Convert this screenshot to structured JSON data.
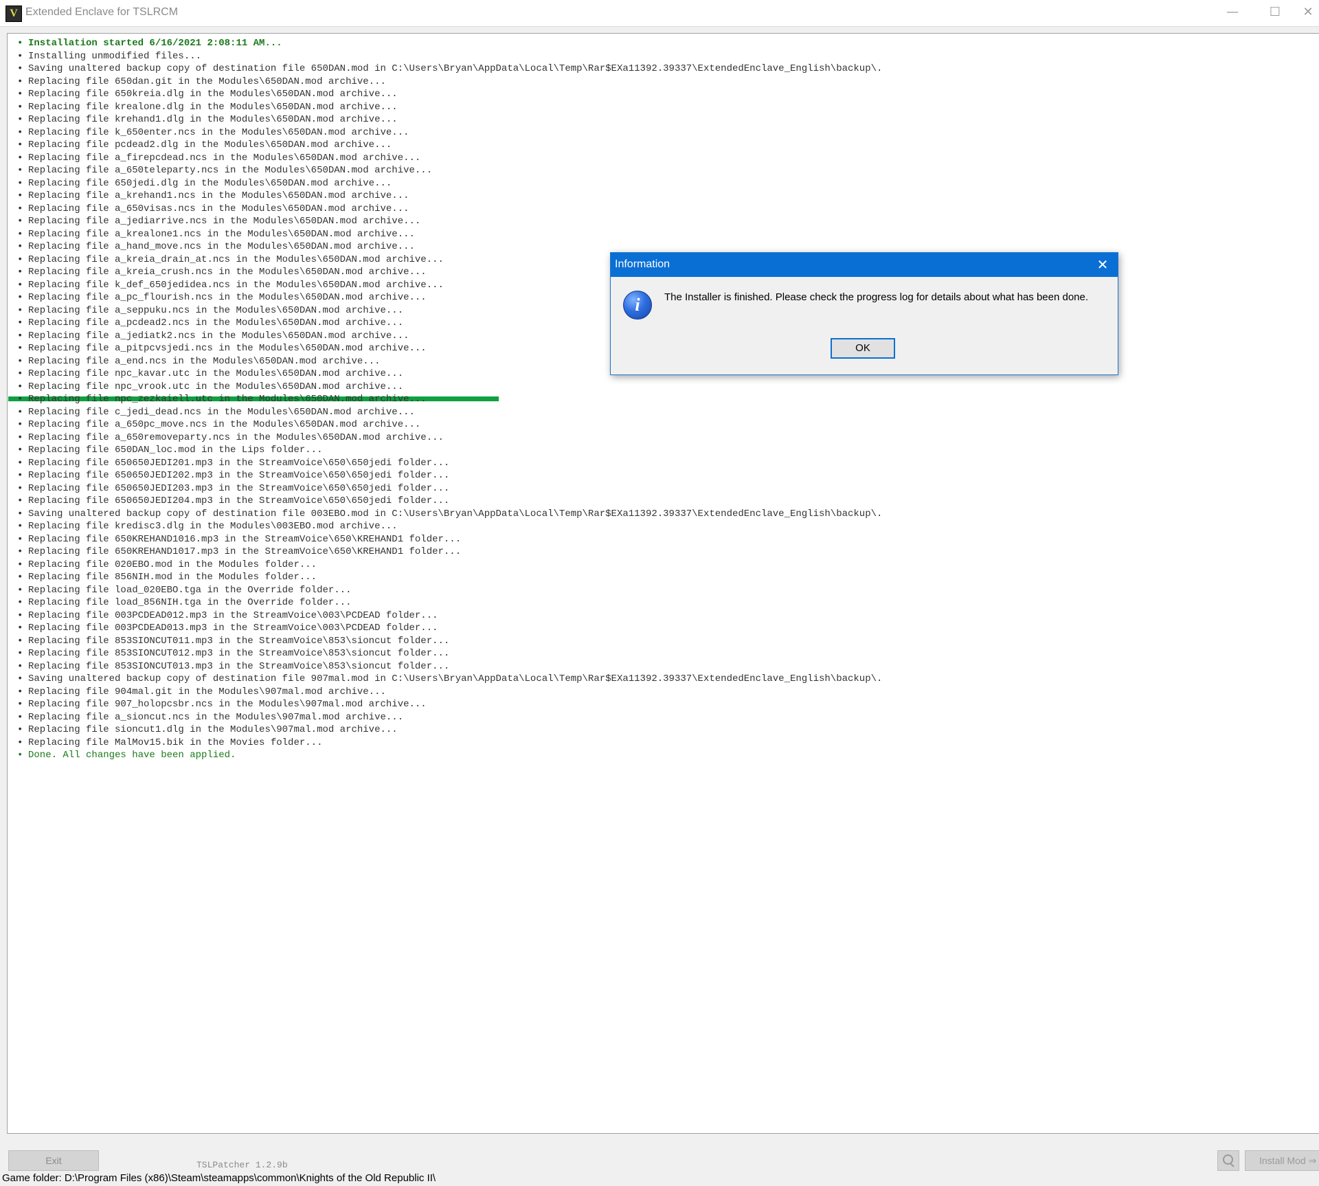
{
  "window": {
    "title": "Extended Enclave for TSLRCM",
    "app_icon_glyph": "V",
    "controls": {
      "minimize": "—",
      "maximize": "☐",
      "close": "✕"
    }
  },
  "log": {
    "lines": [
      {
        "text": "Installation started 6/16/2021 2:08:11 AM...",
        "style": "green"
      },
      {
        "text": "Installing unmodified files...",
        "style": "normal"
      },
      {
        "text": "Saving unaltered backup copy of destination file 650DAN.mod in C:\\Users\\Bryan\\AppData\\Local\\Temp\\Rar$EXa11392.39337\\ExtendedEnclave_English\\backup\\.",
        "style": "normal"
      },
      {
        "text": "Replacing file 650dan.git in the Modules\\650DAN.mod archive...",
        "style": "normal"
      },
      {
        "text": "Replacing file 650kreia.dlg in the Modules\\650DAN.mod archive...",
        "style": "normal"
      },
      {
        "text": "Replacing file krealone.dlg in the Modules\\650DAN.mod archive...",
        "style": "normal"
      },
      {
        "text": "Replacing file krehand1.dlg in the Modules\\650DAN.mod archive...",
        "style": "normal"
      },
      {
        "text": "Replacing file k_650enter.ncs in the Modules\\650DAN.mod archive...",
        "style": "normal"
      },
      {
        "text": "Replacing file pcdead2.dlg in the Modules\\650DAN.mod archive...",
        "style": "normal"
      },
      {
        "text": "Replacing file a_firepcdead.ncs in the Modules\\650DAN.mod archive...",
        "style": "normal"
      },
      {
        "text": "Replacing file a_650teleparty.ncs in the Modules\\650DAN.mod archive...",
        "style": "normal"
      },
      {
        "text": "Replacing file 650jedi.dlg in the Modules\\650DAN.mod archive...",
        "style": "normal"
      },
      {
        "text": "Replacing file a_krehand1.ncs in the Modules\\650DAN.mod archive...",
        "style": "normal"
      },
      {
        "text": "Replacing file a_650visas.ncs in the Modules\\650DAN.mod archive...",
        "style": "normal"
      },
      {
        "text": "Replacing file a_jediarrive.ncs in the Modules\\650DAN.mod archive...",
        "style": "normal"
      },
      {
        "text": "Replacing file a_krealone1.ncs in the Modules\\650DAN.mod archive...",
        "style": "normal"
      },
      {
        "text": "Replacing file a_hand_move.ncs in the Modules\\650DAN.mod archive...",
        "style": "normal"
      },
      {
        "text": "Replacing file a_kreia_drain_at.ncs in the Modules\\650DAN.mod archive...",
        "style": "normal"
      },
      {
        "text": "Replacing file a_kreia_crush.ncs in the Modules\\650DAN.mod archive...",
        "style": "normal"
      },
      {
        "text": "Replacing file k_def_650jedidea.ncs in the Modules\\650DAN.mod archive...",
        "style": "normal"
      },
      {
        "text": "Replacing file a_pc_flourish.ncs in the Modules\\650DAN.mod archive...",
        "style": "normal"
      },
      {
        "text": "Replacing file a_seppuku.ncs in the Modules\\650DAN.mod archive...",
        "style": "normal"
      },
      {
        "text": "Replacing file a_pcdead2.ncs in the Modules\\650DAN.mod archive...",
        "style": "normal"
      },
      {
        "text": "Replacing file a_jediatk2.ncs in the Modules\\650DAN.mod archive...",
        "style": "normal"
      },
      {
        "text": "Replacing file a_pitpcvsjedi.ncs in the Modules\\650DAN.mod archive...",
        "style": "normal"
      },
      {
        "text": "Replacing file a_end.ncs in the Modules\\650DAN.mod archive...",
        "style": "normal"
      },
      {
        "text": "Replacing file npc_kavar.utc in the Modules\\650DAN.mod archive...",
        "style": "normal"
      },
      {
        "text": "Replacing file npc_vrook.utc in the Modules\\650DAN.mod archive...",
        "style": "normal"
      },
      {
        "text": "Replacing file npc_zezkaiell.utc in the Modules\\650DAN.mod archive...",
        "style": "normal"
      },
      {
        "text": "Replacing file c_jedi_dead.ncs in the Modules\\650DAN.mod archive...",
        "style": "normal"
      },
      {
        "text": "Replacing file a_650pc_move.ncs in the Modules\\650DAN.mod archive...",
        "style": "normal"
      },
      {
        "text": "Replacing file a_650removeparty.ncs in the Modules\\650DAN.mod archive...",
        "style": "normal"
      },
      {
        "text": "Replacing file 650DAN_loc.mod in the Lips folder...",
        "style": "normal"
      },
      {
        "text": "Replacing file 650650JEDI201.mp3 in the StreamVoice\\650\\650jedi folder...",
        "style": "normal"
      },
      {
        "text": "Replacing file 650650JEDI202.mp3 in the StreamVoice\\650\\650jedi folder...",
        "style": "normal"
      },
      {
        "text": "Replacing file 650650JEDI203.mp3 in the StreamVoice\\650\\650jedi folder...",
        "style": "normal"
      },
      {
        "text": "Replacing file 650650JEDI204.mp3 in the StreamVoice\\650\\650jedi folder...",
        "style": "normal"
      },
      {
        "text": "Saving unaltered backup copy of destination file 003EBO.mod in C:\\Users\\Bryan\\AppData\\Local\\Temp\\Rar$EXa11392.39337\\ExtendedEnclave_English\\backup\\.",
        "style": "normal"
      },
      {
        "text": "Replacing file kredisc3.dlg in the Modules\\003EBO.mod archive...",
        "style": "normal"
      },
      {
        "text": "Replacing file 650KREHAND1016.mp3 in the StreamVoice\\650\\KREHAND1 folder...",
        "style": "normal"
      },
      {
        "text": "Replacing file 650KREHAND1017.mp3 in the StreamVoice\\650\\KREHAND1 folder...",
        "style": "normal"
      },
      {
        "text": "Replacing file 020EBO.mod in the Modules folder...",
        "style": "normal"
      },
      {
        "text": "Replacing file 856NIH.mod in the Modules folder...",
        "style": "normal"
      },
      {
        "text": "Replacing file load_020EBO.tga in the Override folder...",
        "style": "normal"
      },
      {
        "text": "Replacing file load_856NIH.tga in the Override folder...",
        "style": "normal"
      },
      {
        "text": "Replacing file 003PCDEAD012.mp3 in the StreamVoice\\003\\PCDEAD folder...",
        "style": "normal"
      },
      {
        "text": "Replacing file 003PCDEAD013.mp3 in the StreamVoice\\003\\PCDEAD folder...",
        "style": "normal"
      },
      {
        "text": "Replacing file 853SIONCUT011.mp3 in the StreamVoice\\853\\sioncut folder...",
        "style": "normal"
      },
      {
        "text": "Replacing file 853SIONCUT012.mp3 in the StreamVoice\\853\\sioncut folder...",
        "style": "normal"
      },
      {
        "text": "Replacing file 853SIONCUT013.mp3 in the StreamVoice\\853\\sioncut folder...",
        "style": "normal"
      },
      {
        "text": "Saving unaltered backup copy of destination file 907mal.mod in C:\\Users\\Bryan\\AppData\\Local\\Temp\\Rar$EXa11392.39337\\ExtendedEnclave_English\\backup\\.",
        "style": "normal"
      },
      {
        "text": "Replacing file 904mal.git in the Modules\\907mal.mod archive...",
        "style": "normal"
      },
      {
        "text": "Replacing file 907_holopcsbr.ncs in the Modules\\907mal.mod archive...",
        "style": "normal"
      },
      {
        "text": "Replacing file a_sioncut.ncs in the Modules\\907mal.mod archive...",
        "style": "normal"
      },
      {
        "text": "Replacing file sioncut1.dlg in the Modules\\907mal.mod archive...",
        "style": "normal"
      },
      {
        "text": "Replacing file MalMov15.bik in the Movies folder...",
        "style": "normal"
      },
      {
        "text": "Done. All changes have been applied.",
        "style": "green-plain"
      }
    ]
  },
  "dialog": {
    "title": "Information",
    "close_glyph": "✕",
    "icon": "info-icon",
    "icon_glyph": "i",
    "message": "The Installer is finished. Please check the progress log for details about what has been done.",
    "ok_label": "OK"
  },
  "footer": {
    "exit_label": "Exit",
    "version": "TSLPatcher 1.2.9b",
    "search_icon": "search-icon",
    "install_label": "Install Mod ⇒",
    "status_text": "Game folder: D:\\Program Files (x86)\\Steam\\steamapps\\common\\Knights of the Old Republic II\\"
  },
  "colors": {
    "log_green": "#1a7a1a",
    "progress_green": "#10a040",
    "dialog_title_blue": "#0a6fd4"
  }
}
